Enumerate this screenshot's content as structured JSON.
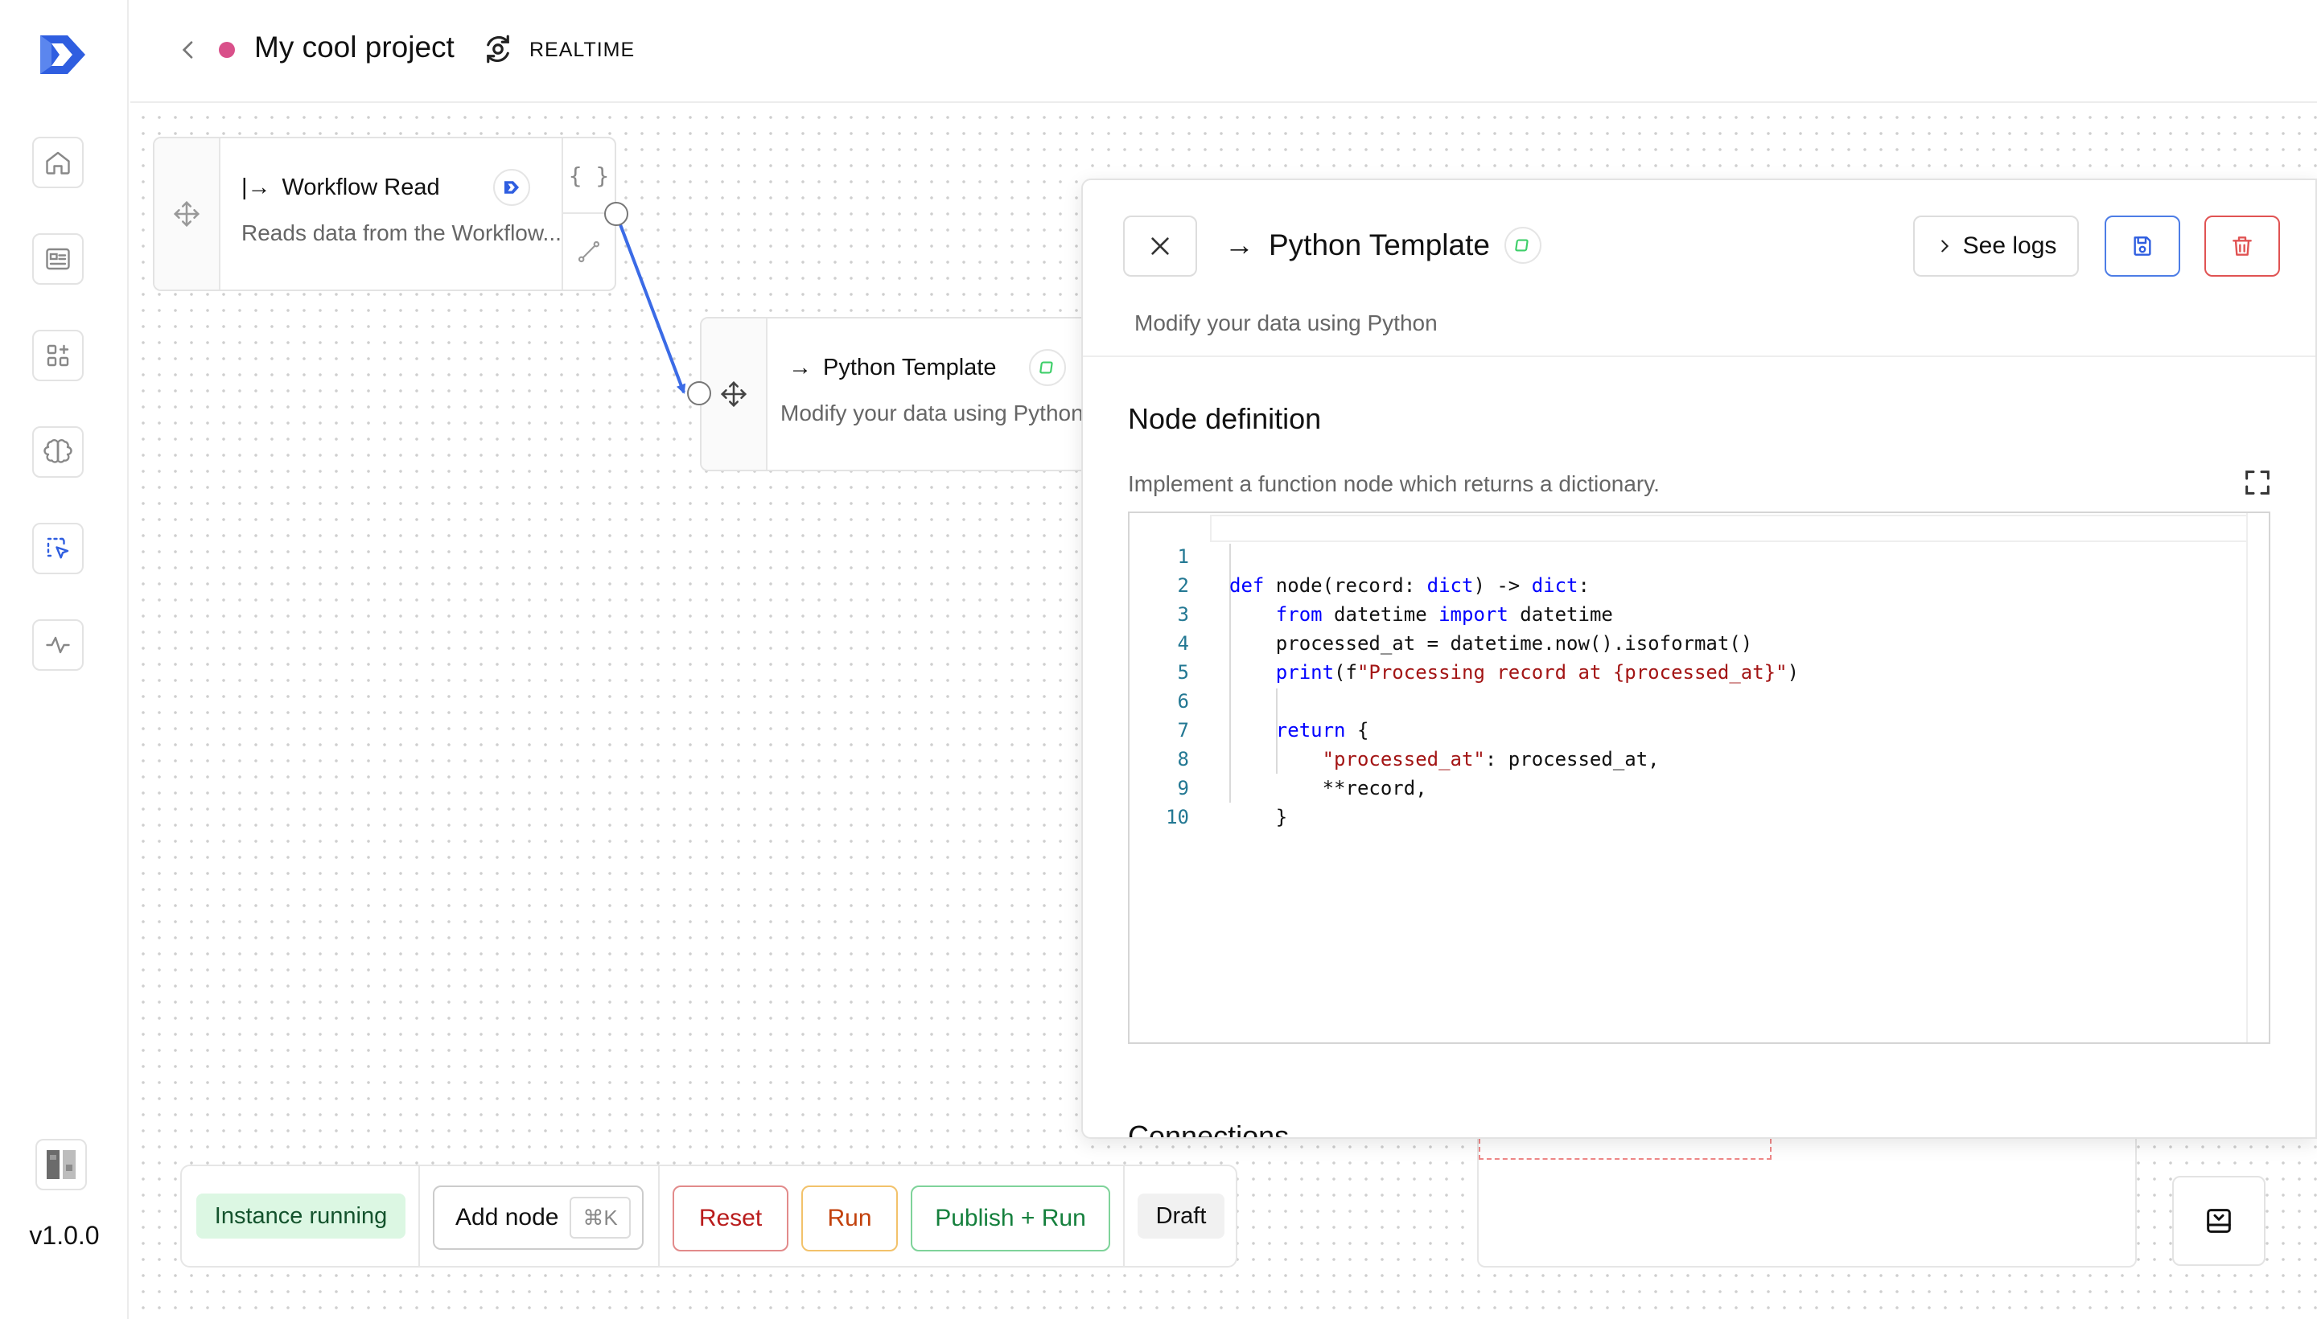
{
  "app": {
    "version": "v1.0.0",
    "accent": "#2f5ee0"
  },
  "sidebar": {
    "items": [
      {
        "icon": "home-icon"
      },
      {
        "icon": "id-card-icon"
      },
      {
        "icon": "apps-add-icon"
      },
      {
        "icon": "brain-icon"
      },
      {
        "icon": "workflow-select-icon",
        "active": true
      },
      {
        "icon": "activity-icon"
      }
    ]
  },
  "header": {
    "project_title": "My cool project",
    "mode_label": "REALTIME",
    "status_color": "#d9508a"
  },
  "nodes": [
    {
      "title_prefix": "|→",
      "title": "Workflow Read",
      "description": "Reads data from the Workflow..."
    },
    {
      "title_prefix": "→",
      "title": "Python Template",
      "description": "Modify your data using Python"
    }
  ],
  "panel": {
    "title_prefix": "→",
    "title": "Python Template",
    "subtitle": "Modify your data using Python",
    "see_logs_label": "See logs",
    "section_title": "Node definition",
    "section_desc": "Implement a function node which returns a dictionary.",
    "next_section_title": "Connections",
    "code_lines": [
      "def node(record: dict) -> dict:",
      "    from datetime import datetime",
      "    processed_at = datetime.now().isoformat()",
      "    print(f\"Processing record at {processed_at}\")",
      "",
      "    return {",
      "        \"processed_at\": processed_at,",
      "        **record,",
      "    }",
      ""
    ],
    "line_numbers": [
      "1",
      "2",
      "3",
      "4",
      "5",
      "6",
      "7",
      "8",
      "9",
      "10"
    ]
  },
  "toolbar": {
    "status_label": "Instance running",
    "add_node_label": "Add node",
    "add_node_shortcut": "⌘K",
    "reset_label": "Reset",
    "run_label": "Run",
    "publish_label": "Publish + Run",
    "draft_label": "Draft"
  }
}
